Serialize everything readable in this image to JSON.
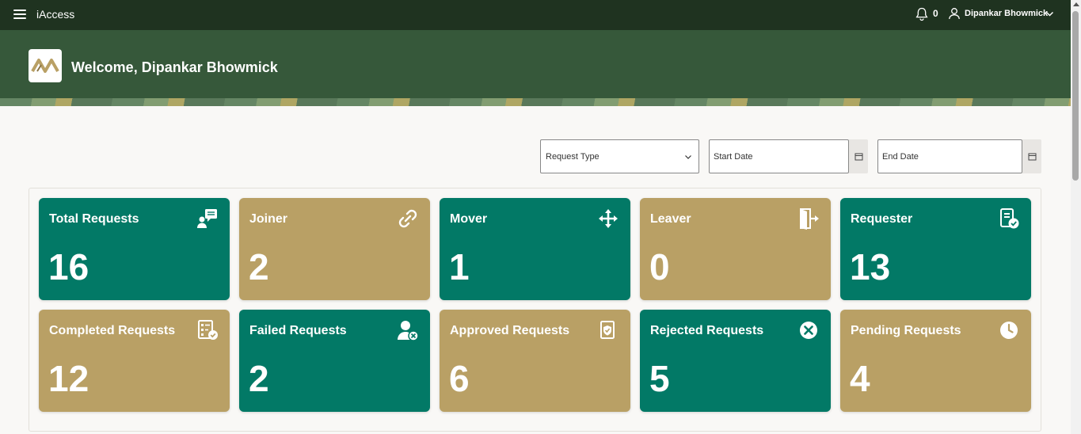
{
  "header": {
    "app_title": "iAccess",
    "notification_count": "0",
    "user_name": "Dipankar Bhowmick"
  },
  "banner": {
    "welcome": "Welcome, Dipankar Bhowmick"
  },
  "filters": {
    "request_type": "Request Type",
    "start_date": "Start Date",
    "end_date": "End Date"
  },
  "cards": [
    {
      "title": "Total Requests",
      "value": "16",
      "icon": "request-chat-icon",
      "color": "#027966"
    },
    {
      "title": "Joiner",
      "value": "2",
      "icon": "link-icon",
      "color": "#b9a065"
    },
    {
      "title": "Mover",
      "value": "1",
      "icon": "move-arrows-icon",
      "color": "#027966"
    },
    {
      "title": "Leaver",
      "value": "0",
      "icon": "exit-door-icon",
      "color": "#b9a065"
    },
    {
      "title": "Requester",
      "value": "13",
      "icon": "file-check-icon",
      "color": "#027966"
    },
    {
      "title": "Completed Requests",
      "value": "12",
      "icon": "checklist-icon",
      "color": "#b9a065"
    },
    {
      "title": "Failed Requests",
      "value": "2",
      "icon": "user-x-icon",
      "color": "#027966"
    },
    {
      "title": "Approved Requests",
      "value": "6",
      "icon": "shield-document-icon",
      "color": "#b9a065"
    },
    {
      "title": "Rejected Requests",
      "value": "5",
      "icon": "circle-x-icon",
      "color": "#027966"
    },
    {
      "title": "Pending Requests",
      "value": "4",
      "icon": "clock-icon",
      "color": "#b9a065"
    }
  ],
  "colors": {
    "topbar": "#1f3320",
    "banner": "#36583a",
    "teal": "#027966",
    "gold": "#b9a065"
  }
}
